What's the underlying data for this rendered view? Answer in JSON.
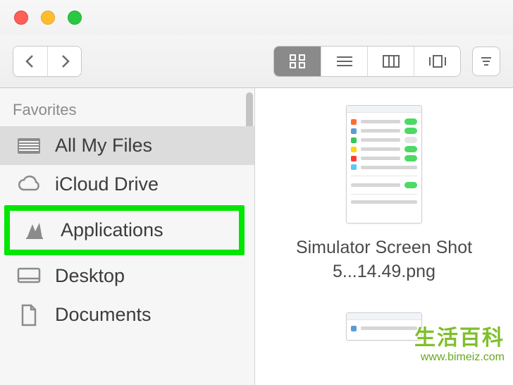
{
  "sidebar": {
    "section_label": "Favorites",
    "items": [
      {
        "label": "All My Files"
      },
      {
        "label": "iCloud Drive"
      },
      {
        "label": "Applications"
      },
      {
        "label": "Desktop"
      },
      {
        "label": "Documents"
      }
    ]
  },
  "content": {
    "file1_name": "Simulator Screen Shot 5...14.49.png"
  },
  "watermark": {
    "title": "生活百科",
    "url": "www.bimeiz.com"
  }
}
